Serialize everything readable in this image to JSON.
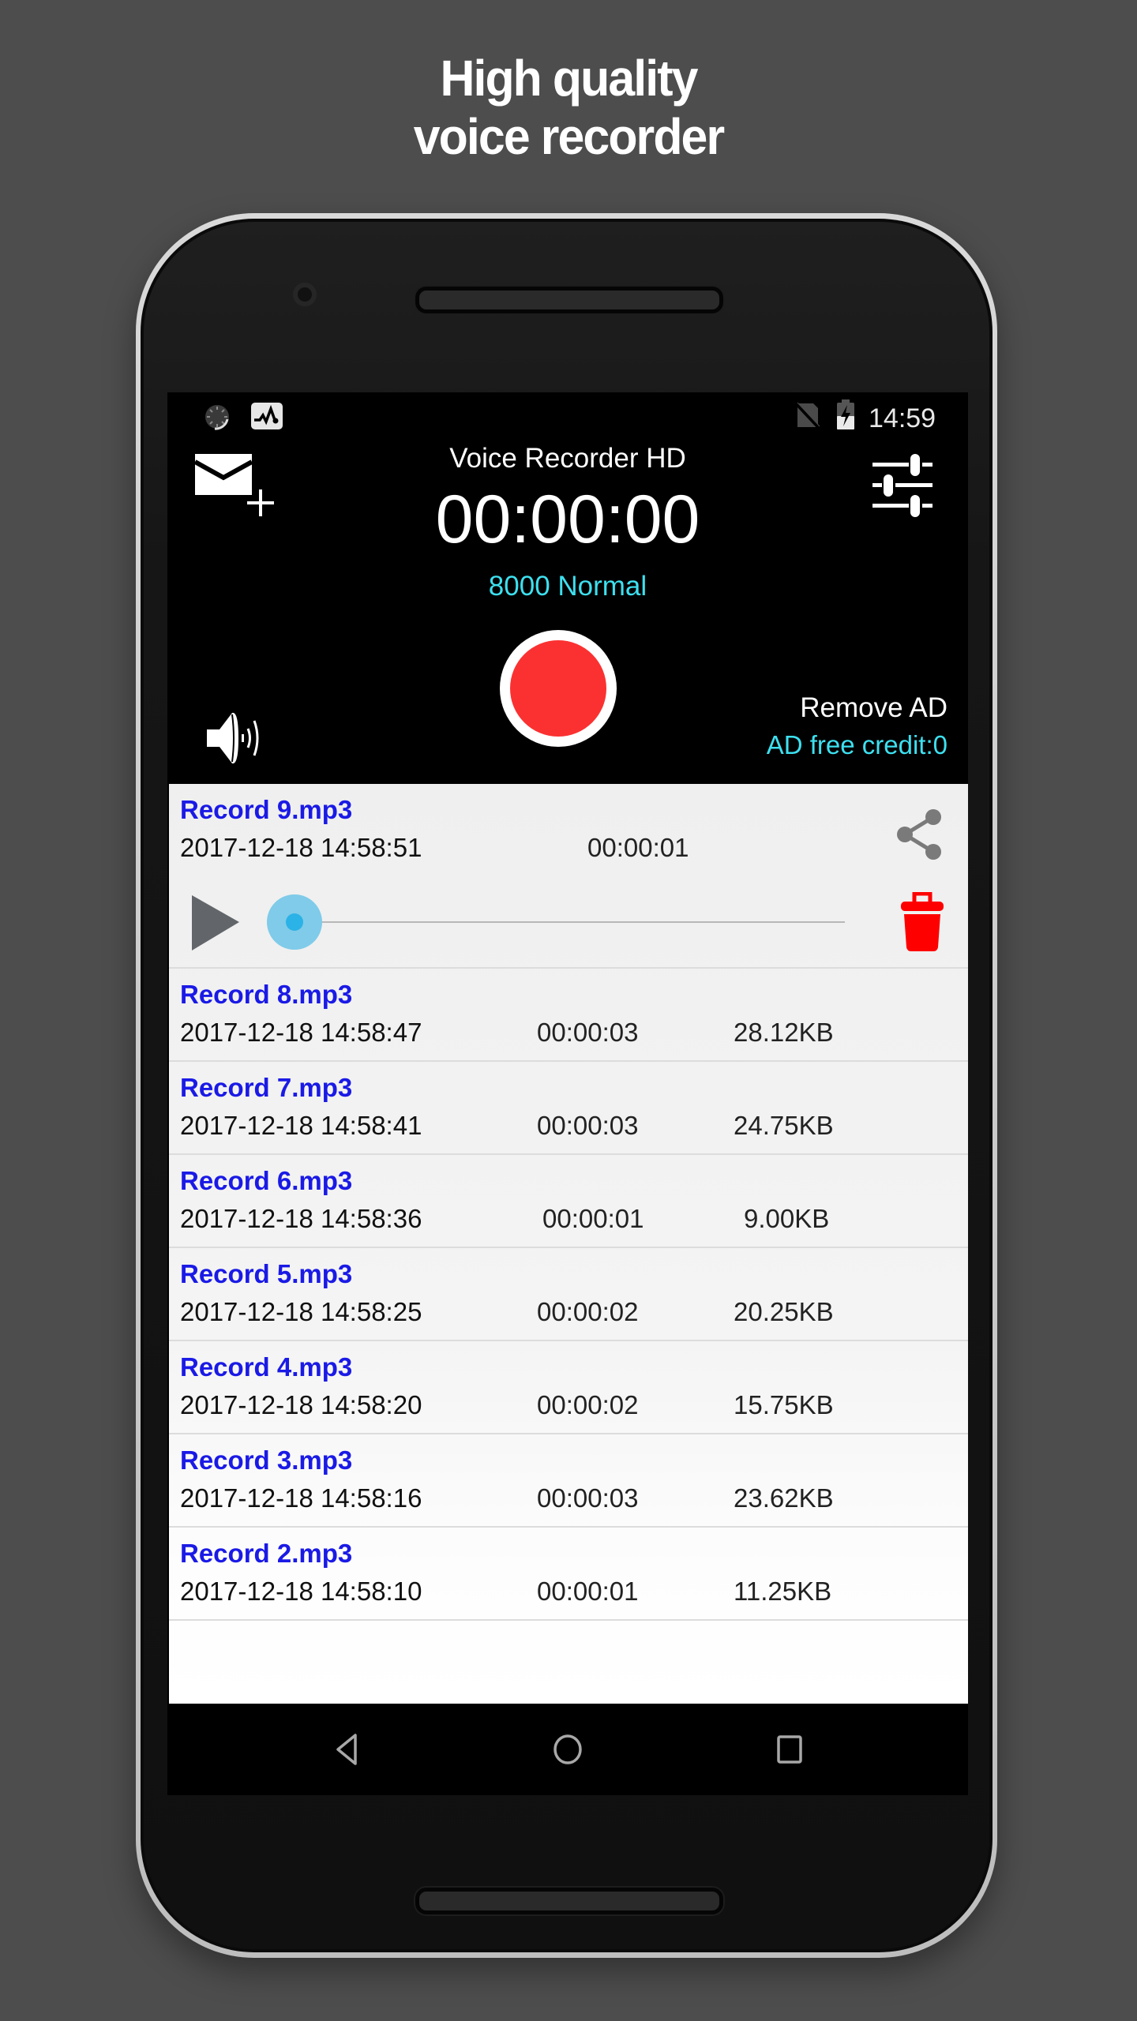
{
  "headline": {
    "line1": "High quality",
    "line2": "voice recorder"
  },
  "status_bar": {
    "time": "14:59",
    "left_icons": [
      "sync-loading-icon",
      "activity-monitor-icon"
    ],
    "right_icons": [
      "no-sim-icon",
      "battery-charging-icon"
    ],
    "battery_level": 0.5
  },
  "header": {
    "app_title": "Voice Recorder HD",
    "timer": "00:00:00",
    "quality": "8000 Normal",
    "remove_ad_label": "Remove AD",
    "ad_credit": "AD free credit:0",
    "email_icon": "email-add-icon",
    "settings_icon": "sliders-settings-icon",
    "speaker_icon": "speaker-volume-icon",
    "record_icon": "record-icon"
  },
  "colors": {
    "accent_cyan": "#3de0f0",
    "record_red": "#fb3131",
    "title_blue": "#1a1ae6",
    "delete_red": "#ff0000",
    "seek_blue": "#2bb2e6"
  },
  "recordings": [
    {
      "name": "Record 9.mp3",
      "date": "2017-12-18 14:58:51",
      "duration": "00:00:01",
      "size": "",
      "expanded": true,
      "progress": 0
    },
    {
      "name": "Record 8.mp3",
      "date": "2017-12-18 14:58:47",
      "duration": "00:00:03",
      "size": "28.12KB"
    },
    {
      "name": "Record 7.mp3",
      "date": "2017-12-18 14:58:41",
      "duration": "00:00:03",
      "size": "24.75KB"
    },
    {
      "name": "Record 6.mp3",
      "date": "2017-12-18 14:58:36",
      "duration": "00:00:01",
      "size": "9.00KB"
    },
    {
      "name": "Record 5.mp3",
      "date": "2017-12-18 14:58:25",
      "duration": "00:00:02",
      "size": "20.25KB"
    },
    {
      "name": "Record 4.mp3",
      "date": "2017-12-18 14:58:20",
      "duration": "00:00:02",
      "size": "15.75KB"
    },
    {
      "name": "Record 3.mp3",
      "date": "2017-12-18 14:58:16",
      "duration": "00:00:03",
      "size": "23.62KB"
    },
    {
      "name": "Record 2.mp3",
      "date": "2017-12-18 14:58:10",
      "duration": "00:00:01",
      "size": "11.25KB"
    }
  ],
  "player": {
    "play_icon": "play-icon",
    "share_icon": "share-icon",
    "delete_icon": "trash-icon"
  },
  "nav_bar": {
    "buttons": [
      "back-icon",
      "home-icon",
      "recents-icon"
    ]
  }
}
